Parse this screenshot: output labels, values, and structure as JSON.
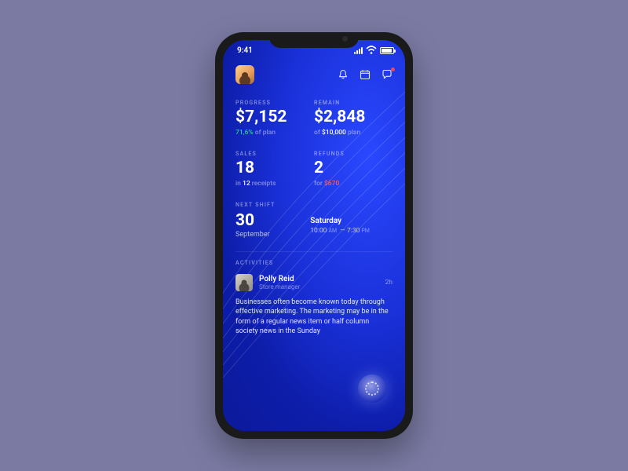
{
  "statusbar": {
    "time": "9:41"
  },
  "header": {
    "bell_icon": "bell-icon",
    "calendar_icon": "calendar-icon",
    "chat_icon": "chat-icon"
  },
  "progress": {
    "label": "PROGRESS",
    "value": "$7,152",
    "percent": "71,6%",
    "suffix": " of plan"
  },
  "remain": {
    "label": "REMAIN",
    "value": "$2,848",
    "prefix": "of ",
    "total": "$10,000",
    "suffix": " plan"
  },
  "sales": {
    "label": "SALES",
    "value": "18",
    "prefix": "in ",
    "receipts": "12",
    "suffix": " receipts"
  },
  "refunds": {
    "label": "REFUNDS",
    "value": "2",
    "prefix": "for ",
    "amount": "$670"
  },
  "shift": {
    "label": "NEXT SHIFT",
    "day": "30",
    "month": "September",
    "weekday": "Saturday",
    "start": "10:00",
    "start_ampm": "AM",
    "dash": "—",
    "end": "7:30",
    "end_ampm": "PM"
  },
  "activities": {
    "label": "ACTIVITIES",
    "items": [
      {
        "name": "Polly Reid",
        "role": "Store manager",
        "time": "2h",
        "body": "Businesses often become known today through effective marketing. The marketing may be in the form of a regular news item or half column society news in the Sunday"
      }
    ]
  },
  "colors": {
    "bg": "#0d1da8",
    "accent_green": "#29d07a",
    "accent_red": "#ff5a5a"
  }
}
